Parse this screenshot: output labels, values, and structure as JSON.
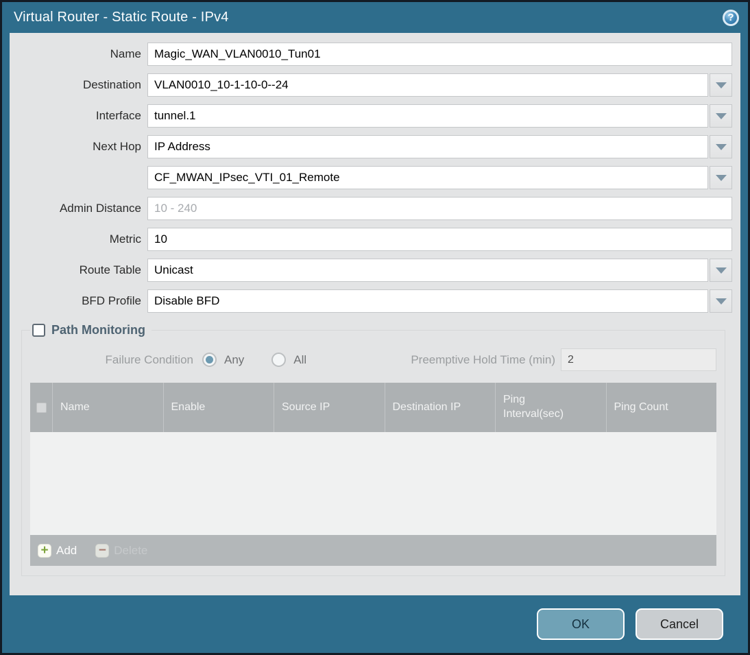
{
  "titlebar": {
    "title": "Virtual Router - Static Route - IPv4",
    "help_glyph": "?"
  },
  "fields": {
    "name": {
      "label": "Name",
      "value": "Magic_WAN_VLAN0010_Tun01"
    },
    "destination": {
      "label": "Destination",
      "value": "VLAN0010_10-1-10-0--24"
    },
    "interface": {
      "label": "Interface",
      "value": "tunnel.1"
    },
    "next_hop": {
      "label": "Next Hop",
      "value": "IP Address"
    },
    "next_hop_address": {
      "value": "CF_MWAN_IPsec_VTI_01_Remote"
    },
    "admin_distance": {
      "label": "Admin Distance",
      "value": "",
      "placeholder": "10 - 240"
    },
    "metric": {
      "label": "Metric",
      "value": "10"
    },
    "route_table": {
      "label": "Route Table",
      "value": "Unicast"
    },
    "bfd_profile": {
      "label": "BFD Profile",
      "value": "Disable BFD"
    }
  },
  "path_monitoring": {
    "title": "Path Monitoring",
    "enabled": false,
    "failure_condition": {
      "label": "Failure Condition",
      "option_any": "Any",
      "option_all": "All",
      "selected": "Any"
    },
    "preemptive_hold_time": {
      "label": "Preemptive Hold Time (min)",
      "value": "2"
    },
    "table": {
      "columns": [
        "Name",
        "Enable",
        "Source IP",
        "Destination IP",
        "Ping Interval(sec)",
        "Ping Count"
      ],
      "rows": [],
      "select_all_checked": false
    },
    "add_label": "Add",
    "delete_label": "Delete",
    "delete_enabled": false
  },
  "footer": {
    "ok_label": "OK",
    "cancel_label": "Cancel"
  },
  "icons": {
    "help_icon": "?",
    "add_icon": "+",
    "delete_icon": "−",
    "dropdown_icon": "triangle-down"
  },
  "colors": {
    "header_teal": "#2e6d8c",
    "body_gray": "#e3e4e5",
    "ok_button": "#70a2b6",
    "cancel_button": "#c9cdd0",
    "add_green": "#7da33c",
    "delete_red": "#a25a48",
    "radio_selected": "#6d9ab1",
    "table_header_gray": "#adb1b3"
  }
}
